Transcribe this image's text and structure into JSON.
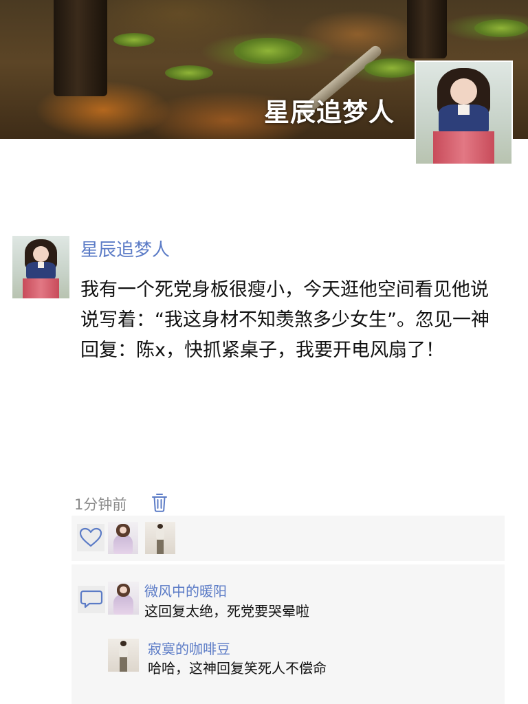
{
  "profile": {
    "name": "星辰追梦人"
  },
  "post": {
    "author": "星辰追梦人",
    "text": "我有一个死党身板很瘦小，今天逛他空间看见他说说写着：“我这身材不知羡煞多少女生”。忽见一神回复：陈x，快抓紧桌子，我要开电风扇了！",
    "time": "1分钟前"
  },
  "comments": [
    {
      "author": "微风中的暖阳",
      "text": "这回复太绝，死党要哭晕啦"
    },
    {
      "author": "寂寞的咖啡豆",
      "text": "哈哈，这神回复笑死人不偿命"
    }
  ],
  "icons": {
    "delete": "trash-icon",
    "like": "heart-icon",
    "comment": "comment-icon"
  },
  "colors": {
    "name_link": "#5b7bc6",
    "panel_bg": "#f6f6f6",
    "time_gray": "#8a8a8a"
  }
}
